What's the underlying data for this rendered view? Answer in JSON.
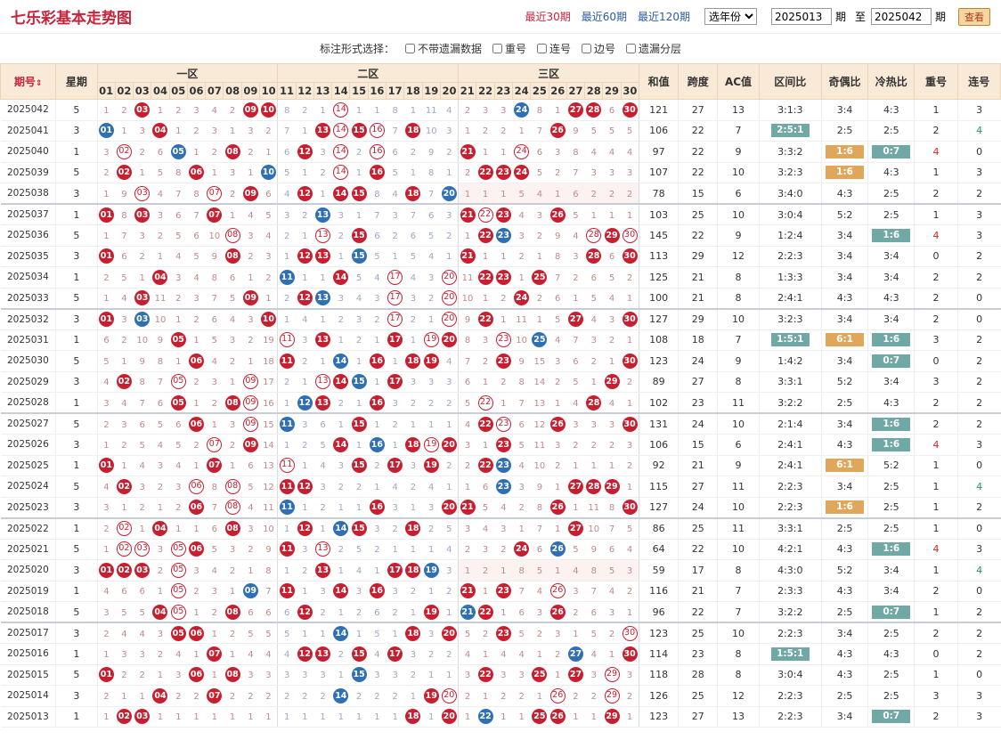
{
  "header": {
    "title": "七乐彩基本走势图",
    "quick_links": [
      "最近30期",
      "最近60期",
      "最近120期"
    ],
    "active_quick": 0,
    "year_select": "选年份",
    "from_value": "2025013",
    "period_label": "期",
    "to_label": "至",
    "to_value": "2025042",
    "query_button": "查看"
  },
  "options": {
    "label": "标注形式选择：",
    "items": [
      "不带遗漏数据",
      "重号",
      "连号",
      "边号",
      "遗漏分层"
    ]
  },
  "table": {
    "col_qihao": "期号",
    "col_week": "星期",
    "zones": [
      "一区",
      "二区",
      "三区"
    ],
    "numbers": [
      "01",
      "02",
      "03",
      "04",
      "05",
      "06",
      "07",
      "08",
      "09",
      "10",
      "11",
      "12",
      "13",
      "14",
      "15",
      "16",
      "17",
      "18",
      "19",
      "20",
      "21",
      "22",
      "23",
      "24",
      "25",
      "26",
      "27",
      "28",
      "29",
      "30"
    ],
    "col_sum": "和值",
    "col_span": "跨度",
    "col_ac": "AC值",
    "col_zone_ratio": "区间比",
    "col_odd_even": "奇偶比",
    "col_hot_cold": "冷热比",
    "col_repeat": "重号",
    "col_consec": "连号",
    "rows": [
      {
        "qi": "2025042",
        "wk": "5",
        "balls": [
          3,
          9,
          10,
          14,
          27,
          28,
          30
        ],
        "blue": 24,
        "sum": "121",
        "span": "27",
        "ac": "13",
        "zr": "3:1:3",
        "oe": "3:4",
        "hc": "4:3",
        "rep": "1",
        "con": "3"
      },
      {
        "qi": "2025041",
        "wk": "3",
        "balls": [
          4,
          13,
          14,
          15,
          16,
          18,
          26
        ],
        "blue": 1,
        "sum": "106",
        "span": "22",
        "ac": "7",
        "zr": "2:5:1",
        "oe": "2:5",
        "hc": "2:5",
        "rep": "2",
        "con": "4"
      },
      {
        "qi": "2025040",
        "wk": "1",
        "balls": [
          2,
          8,
          12,
          14,
          16,
          21,
          24
        ],
        "blue": 5,
        "sum": "97",
        "span": "22",
        "ac": "9",
        "zr": "3:3:2",
        "oe": "1:6",
        "hc": "0:7",
        "rep": "4",
        "con": "0"
      },
      {
        "qi": "2025039",
        "wk": "5",
        "balls": [
          2,
          6,
          14,
          16,
          22,
          23,
          24
        ],
        "blue": 10,
        "sum": "107",
        "span": "22",
        "ac": "10",
        "zr": "3:2:3",
        "oe": "1:6",
        "hc": "4:3",
        "rep": "1",
        "con": "3"
      },
      {
        "qi": "2025038",
        "wk": "3",
        "balls": [
          3,
          7,
          9,
          12,
          14,
          15,
          18
        ],
        "blue": 20,
        "sum": "78",
        "span": "15",
        "ac": "6",
        "zr": "3:4:0",
        "oe": "4:3",
        "hc": "2:5",
        "rep": "2",
        "con": "2"
      },
      {
        "qi": "2025037",
        "wk": "1",
        "balls": [
          1,
          3,
          7,
          21,
          22,
          23,
          26
        ],
        "blue": 13,
        "sum": "103",
        "span": "25",
        "ac": "10",
        "zr": "3:0:4",
        "oe": "5:2",
        "hc": "2:5",
        "rep": "1",
        "con": "3"
      },
      {
        "qi": "2025036",
        "wk": "5",
        "balls": [
          8,
          13,
          15,
          22,
          28,
          29,
          30
        ],
        "blue": 23,
        "sum": "145",
        "span": "22",
        "ac": "9",
        "zr": "1:2:4",
        "oe": "3:4",
        "hc": "1:6",
        "rep": "4",
        "con": "3"
      },
      {
        "qi": "2025035",
        "wk": "3",
        "balls": [
          1,
          8,
          12,
          13,
          21,
          28,
          30
        ],
        "blue": 15,
        "sum": "113",
        "span": "29",
        "ac": "12",
        "zr": "2:2:3",
        "oe": "3:4",
        "hc": "3:4",
        "rep": "0",
        "con": "2"
      },
      {
        "qi": "2025034",
        "wk": "1",
        "balls": [
          4,
          14,
          17,
          20,
          22,
          23,
          25
        ],
        "blue": 11,
        "sum": "125",
        "span": "21",
        "ac": "8",
        "zr": "1:3:3",
        "oe": "3:4",
        "hc": "3:4",
        "rep": "2",
        "con": "2"
      },
      {
        "qi": "2025033",
        "wk": "5",
        "balls": [
          3,
          9,
          12,
          17,
          20,
          24
        ],
        "blue": 13,
        "sum": "100",
        "span": "21",
        "ac": "8",
        "zr": "2:4:1",
        "oe": "4:3",
        "hc": "4:3",
        "rep": "2",
        "con": "0"
      },
      {
        "qi": "2025032",
        "wk": "3",
        "balls": [
          1,
          10,
          17,
          20,
          22,
          27,
          30
        ],
        "blue": 3,
        "sum": "127",
        "span": "29",
        "ac": "10",
        "zr": "3:2:3",
        "oe": "3:4",
        "hc": "3:4",
        "rep": "2",
        "con": "0"
      },
      {
        "qi": "2025031",
        "wk": "1",
        "balls": [
          5,
          11,
          13,
          17,
          19,
          20,
          23
        ],
        "blue": 25,
        "sum": "108",
        "span": "18",
        "ac": "7",
        "zr": "1:5:1",
        "oe": "6:1",
        "hc": "1:6",
        "rep": "3",
        "con": "2"
      },
      {
        "qi": "2025030",
        "wk": "5",
        "balls": [
          6,
          11,
          16,
          18,
          19,
          23,
          30
        ],
        "blue": 14,
        "sum": "123",
        "span": "24",
        "ac": "9",
        "zr": "1:4:2",
        "oe": "3:4",
        "hc": "0:7",
        "rep": "0",
        "con": "2"
      },
      {
        "qi": "2025029",
        "wk": "3",
        "balls": [
          2,
          5,
          9,
          13,
          14,
          17,
          29
        ],
        "blue": 15,
        "sum": "89",
        "span": "27",
        "ac": "8",
        "zr": "3:3:1",
        "oe": "5:2",
        "hc": "3:4",
        "rep": "3",
        "con": "2"
      },
      {
        "qi": "2025028",
        "wk": "1",
        "balls": [
          5,
          8,
          9,
          13,
          16,
          22,
          28
        ],
        "blue": 12,
        "sum": "102",
        "span": "23",
        "ac": "11",
        "zr": "3:2:2",
        "oe": "2:5",
        "hc": "4:3",
        "rep": "2",
        "con": "2"
      },
      {
        "qi": "2025027",
        "wk": "5",
        "balls": [
          6,
          9,
          15,
          22,
          23,
          26,
          30
        ],
        "blue": 11,
        "sum": "131",
        "span": "24",
        "ac": "10",
        "zr": "2:1:4",
        "oe": "3:4",
        "hc": "1:6",
        "rep": "2",
        "con": "2"
      },
      {
        "qi": "2025026",
        "wk": "3",
        "balls": [
          7,
          9,
          14,
          18,
          19,
          20,
          23
        ],
        "blue": 16,
        "sum": "106",
        "span": "15",
        "ac": "6",
        "zr": "2:4:1",
        "oe": "4:3",
        "hc": "1:6",
        "rep": "4",
        "con": "3"
      },
      {
        "qi": "2025025",
        "wk": "1",
        "balls": [
          1,
          7,
          11,
          15,
          17,
          19,
          22
        ],
        "blue": 23,
        "sum": "92",
        "span": "21",
        "ac": "9",
        "zr": "2:4:1",
        "oe": "6:1",
        "hc": "5:2",
        "rep": "1",
        "con": "0"
      },
      {
        "qi": "2025024",
        "wk": "5",
        "balls": [
          2,
          6,
          8,
          11,
          12,
          27,
          28,
          29
        ],
        "blue": 23,
        "sum": "115",
        "span": "27",
        "ac": "11",
        "zr": "2:2:3",
        "oe": "3:4",
        "hc": "2:5",
        "rep": "1",
        "con": "4"
      },
      {
        "qi": "2025023",
        "wk": "3",
        "balls": [
          6,
          8,
          16,
          20,
          21,
          26,
          30
        ],
        "blue": 11,
        "sum": "127",
        "span": "24",
        "ac": "10",
        "zr": "2:2:3",
        "oe": "1:6",
        "hc": "2:5",
        "rep": "1",
        "con": "2"
      },
      {
        "qi": "2025022",
        "wk": "1",
        "balls": [
          2,
          4,
          8,
          12,
          15,
          18,
          27
        ],
        "blue": 14,
        "sum": "86",
        "span": "25",
        "ac": "11",
        "zr": "3:3:1",
        "oe": "2:5",
        "hc": "2:5",
        "rep": "1",
        "con": "0"
      },
      {
        "qi": "2025021",
        "wk": "5",
        "balls": [
          2,
          3,
          5,
          6,
          11,
          13,
          24
        ],
        "blue": 26,
        "sum": "64",
        "span": "22",
        "ac": "10",
        "zr": "4:2:1",
        "oe": "4:3",
        "hc": "1:6",
        "rep": "4",
        "con": "3"
      },
      {
        "qi": "2025020",
        "wk": "3",
        "balls": [
          1,
          2,
          3,
          5,
          13,
          17,
          18
        ],
        "blue": 19,
        "sum": "59",
        "span": "17",
        "ac": "8",
        "zr": "4:3:0",
        "oe": "5:2",
        "hc": "3:4",
        "rep": "1",
        "con": "4"
      },
      {
        "qi": "2025019",
        "wk": "1",
        "balls": [
          5,
          11,
          14,
          16,
          21,
          23,
          26
        ],
        "blue": 9,
        "sum": "116",
        "span": "21",
        "ac": "7",
        "zr": "2:3:3",
        "oe": "4:3",
        "hc": "3:4",
        "rep": "2",
        "con": "0"
      },
      {
        "qi": "2025018",
        "wk": "5",
        "balls": [
          4,
          5,
          8,
          12,
          19,
          22,
          26
        ],
        "blue": 21,
        "sum": "96",
        "span": "22",
        "ac": "7",
        "zr": "3:2:2",
        "oe": "2:5",
        "hc": "0:7",
        "rep": "1",
        "con": "2"
      },
      {
        "qi": "2025017",
        "wk": "3",
        "balls": [
          5,
          6,
          18,
          20,
          23,
          30
        ],
        "blue": 14,
        "sum": "123",
        "span": "25",
        "ac": "10",
        "zr": "2:2:3",
        "oe": "3:4",
        "hc": "2:5",
        "rep": "2",
        "con": "2"
      },
      {
        "qi": "2025016",
        "wk": "1",
        "balls": [
          7,
          12,
          13,
          15,
          17,
          30
        ],
        "blue": 27,
        "sum": "114",
        "span": "23",
        "ac": "8",
        "zr": "1:5:1",
        "oe": "4:3",
        "hc": "4:3",
        "rep": "0",
        "con": "2"
      },
      {
        "qi": "2025015",
        "wk": "5",
        "balls": [
          1,
          6,
          8,
          22,
          25,
          27,
          29
        ],
        "blue": 15,
        "sum": "118",
        "span": "28",
        "ac": "8",
        "zr": "3:0:4",
        "oe": "4:3",
        "hc": "2:5",
        "rep": "1",
        "con": "0"
      },
      {
        "qi": "2025014",
        "wk": "3",
        "balls": [
          4,
          7,
          19,
          20,
          26,
          29
        ],
        "blue": 14,
        "sum": "126",
        "span": "25",
        "ac": "12",
        "zr": "2:2:3",
        "oe": "2:5",
        "hc": "2:5",
        "rep": "3",
        "con": "3"
      },
      {
        "qi": "2025013",
        "wk": "1",
        "balls": [
          2,
          3,
          18,
          20,
          25,
          26,
          29
        ],
        "blue": 22,
        "sum": "123",
        "span": "27",
        "ac": "13",
        "zr": "2:2:3",
        "oe": "3:4",
        "hc": "0:7",
        "rep": "2",
        "con": "3"
      }
    ]
  },
  "badge_colors": {
    "teal": "#6fa8a4",
    "orange": "#e0a65a",
    "red": "#c81f30",
    "blue": "#2f6fb3"
  }
}
